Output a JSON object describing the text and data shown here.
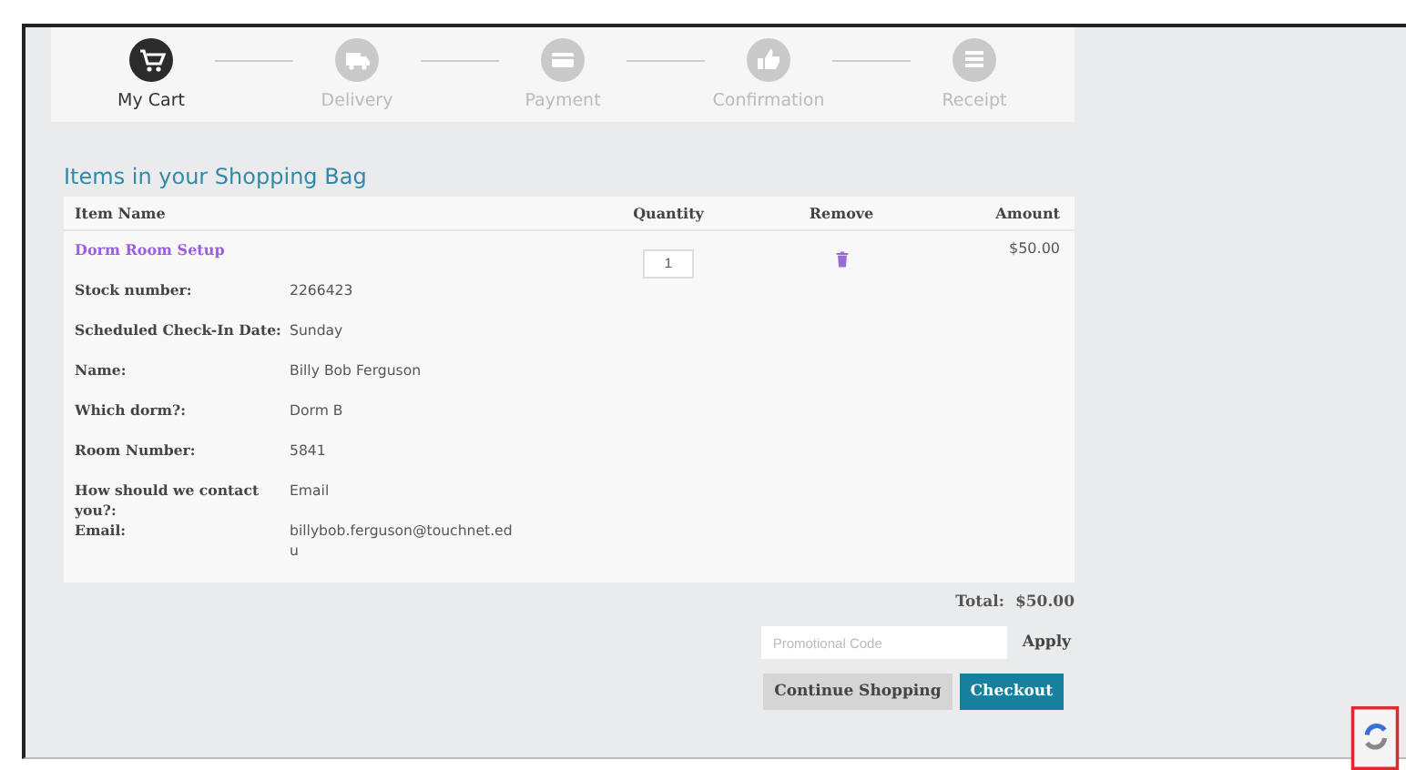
{
  "steps": [
    {
      "label": "My Cart",
      "selected": true,
      "kind": "cart"
    },
    {
      "label": "Delivery",
      "selected": false,
      "kind": "truck"
    },
    {
      "label": "Payment",
      "selected": false,
      "kind": "card"
    },
    {
      "label": "Confirmation",
      "selected": false,
      "kind": "thumb"
    },
    {
      "label": "Receipt",
      "selected": false,
      "kind": "list"
    }
  ],
  "section_title": "Items in your Shopping Bag",
  "table": {
    "columns": [
      "Item Name",
      "Quantity",
      "Remove",
      "Amount"
    ],
    "item": {
      "name": "Dorm Room Setup",
      "quantity": "1",
      "amount": "$50.00"
    },
    "details": [
      {
        "label": "Stock number:",
        "value": "2266423"
      },
      {
        "label": "Scheduled Check-In Date:",
        "value": "Sunday"
      },
      {
        "label": "Name:",
        "value": "Billy Bob Ferguson"
      },
      {
        "label": "Which dorm?:",
        "value": "Dorm B"
      },
      {
        "label": "Room Number:",
        "value": "5841"
      },
      {
        "label": "How should we contact you?:",
        "value": "Email"
      },
      {
        "label": "Email:",
        "value": "billybob.ferguson@touchnet.edu"
      }
    ]
  },
  "total": {
    "label": "Total:",
    "value": "$50.00"
  },
  "promo": {
    "placeholder": "Promotional Code",
    "button": "Apply"
  },
  "buttons": [
    {
      "label": "Continue Shopping",
      "kind": "secondary"
    },
    {
      "label": "Checkout",
      "kind": "primary"
    }
  ]
}
